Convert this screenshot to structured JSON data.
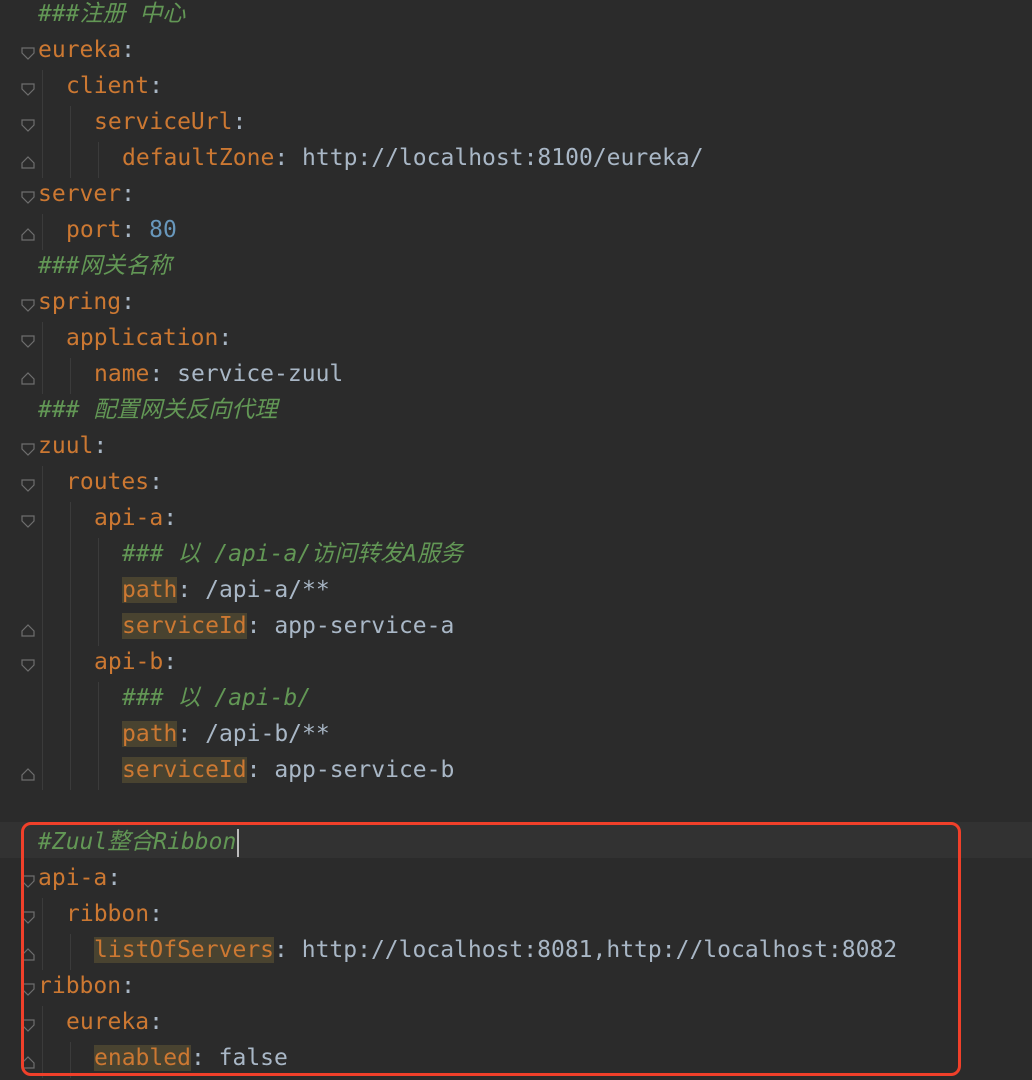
{
  "editor": {
    "language": "yaml",
    "colors": {
      "background": "#2b2b2b",
      "key": "#cc7832",
      "value": "#a9b7c6",
      "number": "#6897bb",
      "comment": "#629755",
      "annotation_box": "#f0402a"
    },
    "lines": {
      "l01": "###注册 中心",
      "l02": "eureka",
      "l03": "client",
      "l04": "serviceUrl",
      "l05_key": "defaultZone",
      "l05_val": "http://localhost:8100/eureka/",
      "l06": "server",
      "l07_key": "port",
      "l07_val": "80",
      "l08": "###网关名称",
      "l09": "spring",
      "l10": "application",
      "l11_key": "name",
      "l11_val": "service-zuul",
      "l12": "### 配置网关反向代理",
      "l13": "zuul",
      "l14": "routes",
      "l15": "api-a",
      "l16": "### 以 /api-a/访问转发A服务",
      "l17_key": "path",
      "l17_val": "/api-a/**",
      "l18_key": "serviceId",
      "l18_val": "app-service-a",
      "l19": "api-b",
      "l20": "### 以 /api-b/",
      "l21_key": "path",
      "l21_val": "/api-b/**",
      "l22_key": "serviceId",
      "l22_val": "app-service-b",
      "l24": "#Zuul整合Ribbon",
      "l25": "api-a",
      "l26": "ribbon",
      "l27_key": "listOfServers",
      "l27_val": "http://localhost:8081,http://localhost:8082",
      "l28": "ribbon",
      "l29": "eureka",
      "l30_key": "enabled",
      "l30_val": "false"
    }
  }
}
